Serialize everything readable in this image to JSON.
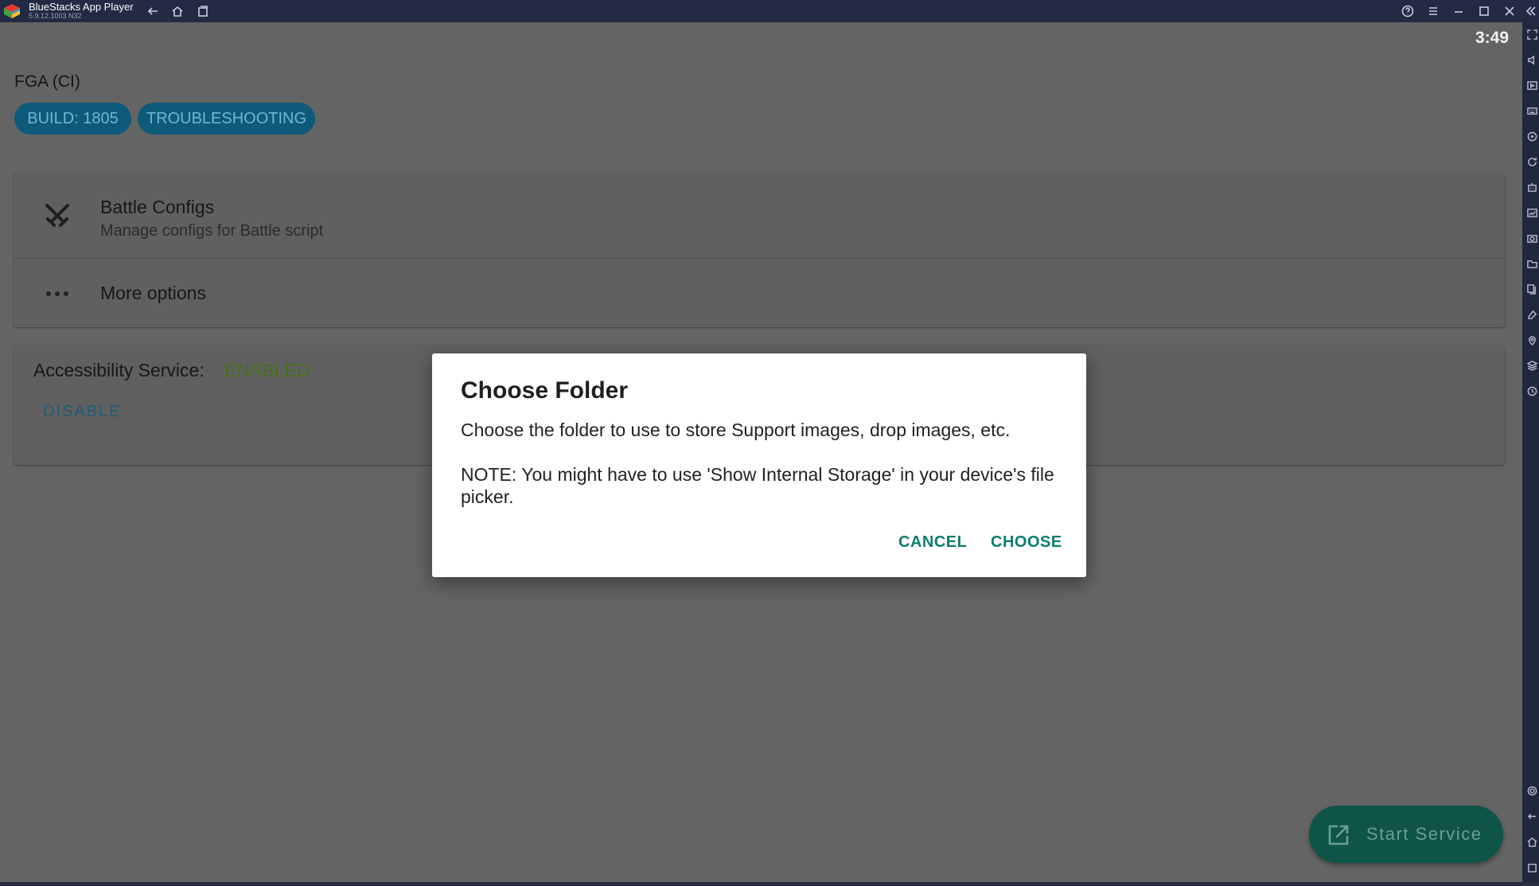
{
  "window": {
    "app_name": "BlueStacks App Player",
    "version": "5.9.12.1003 N32",
    "accent": "#222a44"
  },
  "status_bar": {
    "time": "3:49"
  },
  "app": {
    "title": "FGA (CI)",
    "chips": {
      "build": "BUILD: 1805",
      "troubleshooting": "TROUBLESHOOTING"
    }
  },
  "menu": {
    "battle_configs": {
      "title": "Battle Configs",
      "subtitle": "Manage configs for Battle script",
      "icon": "crossed-swords-icon"
    },
    "more_options": {
      "title": "More options",
      "icon": "more-horizontal-icon"
    }
  },
  "accessibility": {
    "label": "Accessibility Service:",
    "status": "ENABLED",
    "status_color": "#46701e",
    "disable_label": "DISABLE"
  },
  "fab": {
    "label": "Start Service",
    "icon": "open-external-icon"
  },
  "dialog": {
    "title": "Choose Folder",
    "message": "Choose the folder to use to store Support images, drop images, etc.",
    "note": "NOTE: You might have to use 'Show Internal Storage' in your device's file picker.",
    "cancel_label": "CANCEL",
    "choose_label": "CHOOSE",
    "button_color": "#0b7d6f"
  }
}
